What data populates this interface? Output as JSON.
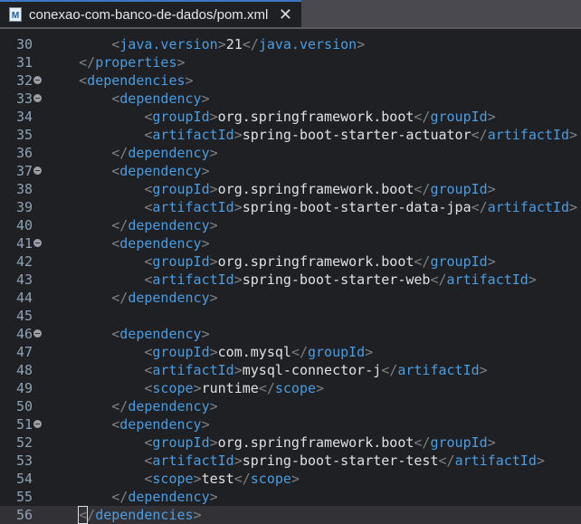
{
  "tab": {
    "title": "conexao-com-banco-de-dados/pom.xml",
    "icon": "M"
  },
  "lines": [
    {
      "n": "30",
      "indent": 2,
      "tag": "java.version",
      "text": "21"
    },
    {
      "n": "31",
      "indent": 1,
      "close": "properties"
    },
    {
      "n": "32",
      "indent": 1,
      "open": "dependencies",
      "fold": true
    },
    {
      "n": "33",
      "indent": 2,
      "open": "dependency",
      "fold": true
    },
    {
      "n": "34",
      "indent": 3,
      "tag": "groupId",
      "text": "org.springframework.boot"
    },
    {
      "n": "35",
      "indent": 3,
      "tag": "artifactId",
      "text": "spring-boot-starter-actuator"
    },
    {
      "n": "36",
      "indent": 2,
      "close": "dependency"
    },
    {
      "n": "37",
      "indent": 2,
      "open": "dependency",
      "fold": true
    },
    {
      "n": "38",
      "indent": 3,
      "tag": "groupId",
      "text": "org.springframework.boot"
    },
    {
      "n": "39",
      "indent": 3,
      "tag": "artifactId",
      "text": "spring-boot-starter-data-jpa"
    },
    {
      "n": "40",
      "indent": 2,
      "close": "dependency"
    },
    {
      "n": "41",
      "indent": 2,
      "open": "dependency",
      "fold": true
    },
    {
      "n": "42",
      "indent": 3,
      "tag": "groupId",
      "text": "org.springframework.boot"
    },
    {
      "n": "43",
      "indent": 3,
      "tag": "artifactId",
      "text": "spring-boot-starter-web"
    },
    {
      "n": "44",
      "indent": 2,
      "close": "dependency"
    },
    {
      "n": "45",
      "indent": 0
    },
    {
      "n": "46",
      "indent": 2,
      "open": "dependency",
      "fold": true
    },
    {
      "n": "47",
      "indent": 3,
      "tag": "groupId",
      "text": "com.mysql"
    },
    {
      "n": "48",
      "indent": 3,
      "tag": "artifactId",
      "text": "mysql-connector-j"
    },
    {
      "n": "49",
      "indent": 3,
      "tag": "scope",
      "text": "runtime"
    },
    {
      "n": "50",
      "indent": 2,
      "close": "dependency"
    },
    {
      "n": "51",
      "indent": 2,
      "open": "dependency",
      "fold": true
    },
    {
      "n": "52",
      "indent": 3,
      "tag": "groupId",
      "text": "org.springframework.boot"
    },
    {
      "n": "53",
      "indent": 3,
      "tag": "artifactId",
      "text": "spring-boot-starter-test"
    },
    {
      "n": "54",
      "indent": 3,
      "tag": "scope",
      "text": "test"
    },
    {
      "n": "55",
      "indent": 2,
      "close": "dependency"
    },
    {
      "n": "56",
      "indent": 1,
      "close": "dependencies",
      "current": true
    }
  ]
}
